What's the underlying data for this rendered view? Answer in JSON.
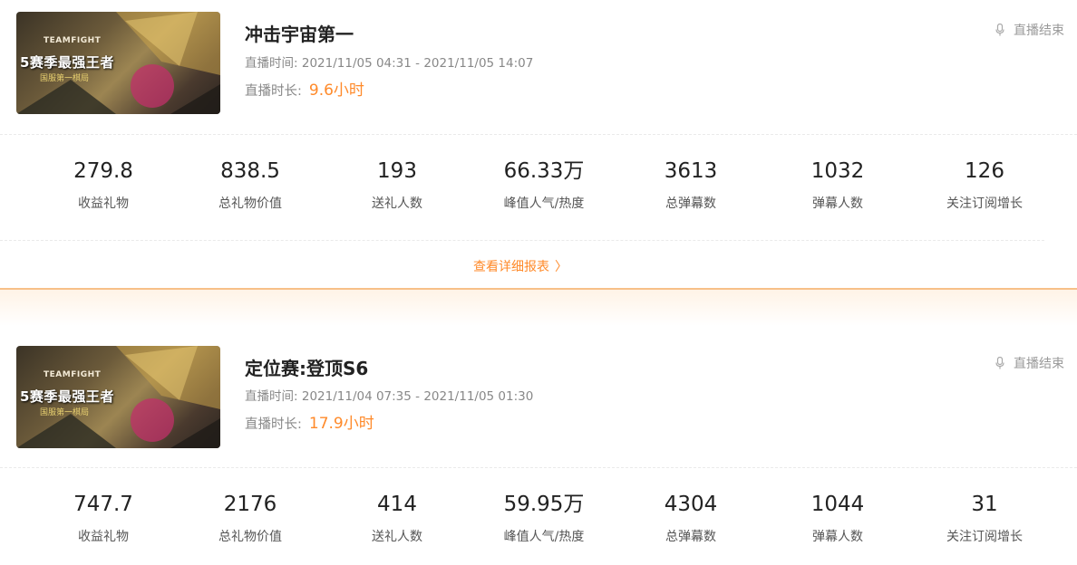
{
  "sessions": [
    {
      "thumbnail": {
        "brand": "TEAMFIGHT",
        "season": "5赛季最强王者",
        "sub": "国服第一棋局"
      },
      "title": "冲击宇宙第一",
      "time_label": "直播时间:",
      "time_range": "2021/11/05 04:31 - 2021/11/05 14:07",
      "duration_label": "直播时长:",
      "duration_value": "9.6小时",
      "status": "直播结束",
      "stats": [
        {
          "value": "279.8",
          "label": "收益礼物"
        },
        {
          "value": "838.5",
          "label": "总礼物价值"
        },
        {
          "value": "193",
          "label": "送礼人数"
        },
        {
          "value": "66.33万",
          "label": "峰值人气/热度"
        },
        {
          "value": "3613",
          "label": "总弹幕数"
        },
        {
          "value": "1032",
          "label": "弹幕人数"
        },
        {
          "value": "126",
          "label": "关注订阅增长"
        }
      ],
      "detail_link": "查看详细报表"
    },
    {
      "thumbnail": {
        "brand": "TEAMFIGHT",
        "season": "5赛季最强王者",
        "sub": "国服第一棋局"
      },
      "title": "定位赛:登顶S6",
      "time_label": "直播时间:",
      "time_range": "2021/11/04 07:35 - 2021/11/05 01:30",
      "duration_label": "直播时长:",
      "duration_value": "17.9小时",
      "status": "直播结束",
      "stats": [
        {
          "value": "747.7",
          "label": "收益礼物"
        },
        {
          "value": "2176",
          "label": "总礼物价值"
        },
        {
          "value": "414",
          "label": "送礼人数"
        },
        {
          "value": "59.95万",
          "label": "峰值人气/热度"
        },
        {
          "value": "4304",
          "label": "总弹幕数"
        },
        {
          "value": "1044",
          "label": "弹幕人数"
        },
        {
          "value": "31",
          "label": "关注订阅增长"
        }
      ]
    }
  ],
  "colors": {
    "accent": "#ff8a2a",
    "separator": "#f7c088"
  },
  "icons": {
    "status": "microphone-icon",
    "detail": "chevron-right-icon"
  }
}
